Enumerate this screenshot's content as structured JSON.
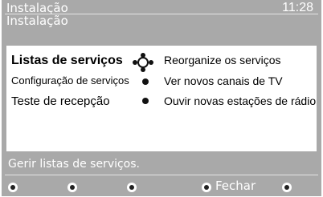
{
  "header": {
    "title": "Instalação",
    "subtitle": "Instalação",
    "clock": "11:28"
  },
  "menu": {
    "items": [
      {
        "label": "Listas de serviços",
        "selected": true
      },
      {
        "label": "Configuração de serviços"
      },
      {
        "label": "Teste de recepção"
      }
    ]
  },
  "submenu": {
    "items": [
      {
        "label": "Reorganize os serviços"
      },
      {
        "label": "Ver novos canais de TV"
      },
      {
        "label": "Ouvir novas estações de rádio"
      }
    ]
  },
  "status": "Gerir listas de serviços.",
  "footer": {
    "close_label": "Fechar"
  },
  "colors": {
    "background": "#a9a9a9",
    "panel": "#ffffff",
    "text": "#000000"
  }
}
